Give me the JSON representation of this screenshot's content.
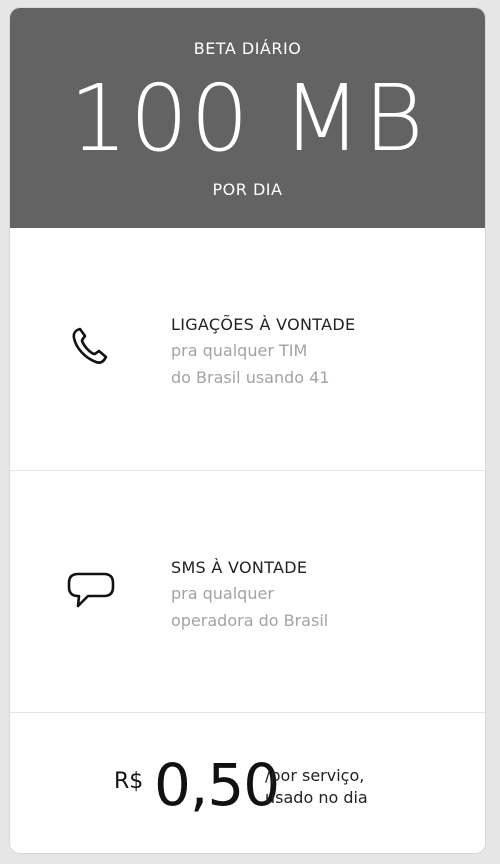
{
  "plan": {
    "name": "BETA DIÁRIO",
    "amount": "100 MB",
    "period": "POR DIA"
  },
  "features": [
    {
      "icon": "phone-icon",
      "title": "LIGAÇÕES À VONTADE",
      "desc_line1": "pra qualquer TIM",
      "desc_line2": "do Brasil usando 41"
    },
    {
      "icon": "chat-bubble-icon",
      "title": "SMS À VONTADE",
      "desc_line1": "pra qualquer",
      "desc_line2": "operadora do Brasil"
    }
  ],
  "price": {
    "currency": "R$",
    "value": "0,50",
    "note_line1": "/por serviço,",
    "note_line2": "usado no dia"
  },
  "colors": {
    "header_bg": "#636363",
    "background": "#e6e6e6"
  }
}
